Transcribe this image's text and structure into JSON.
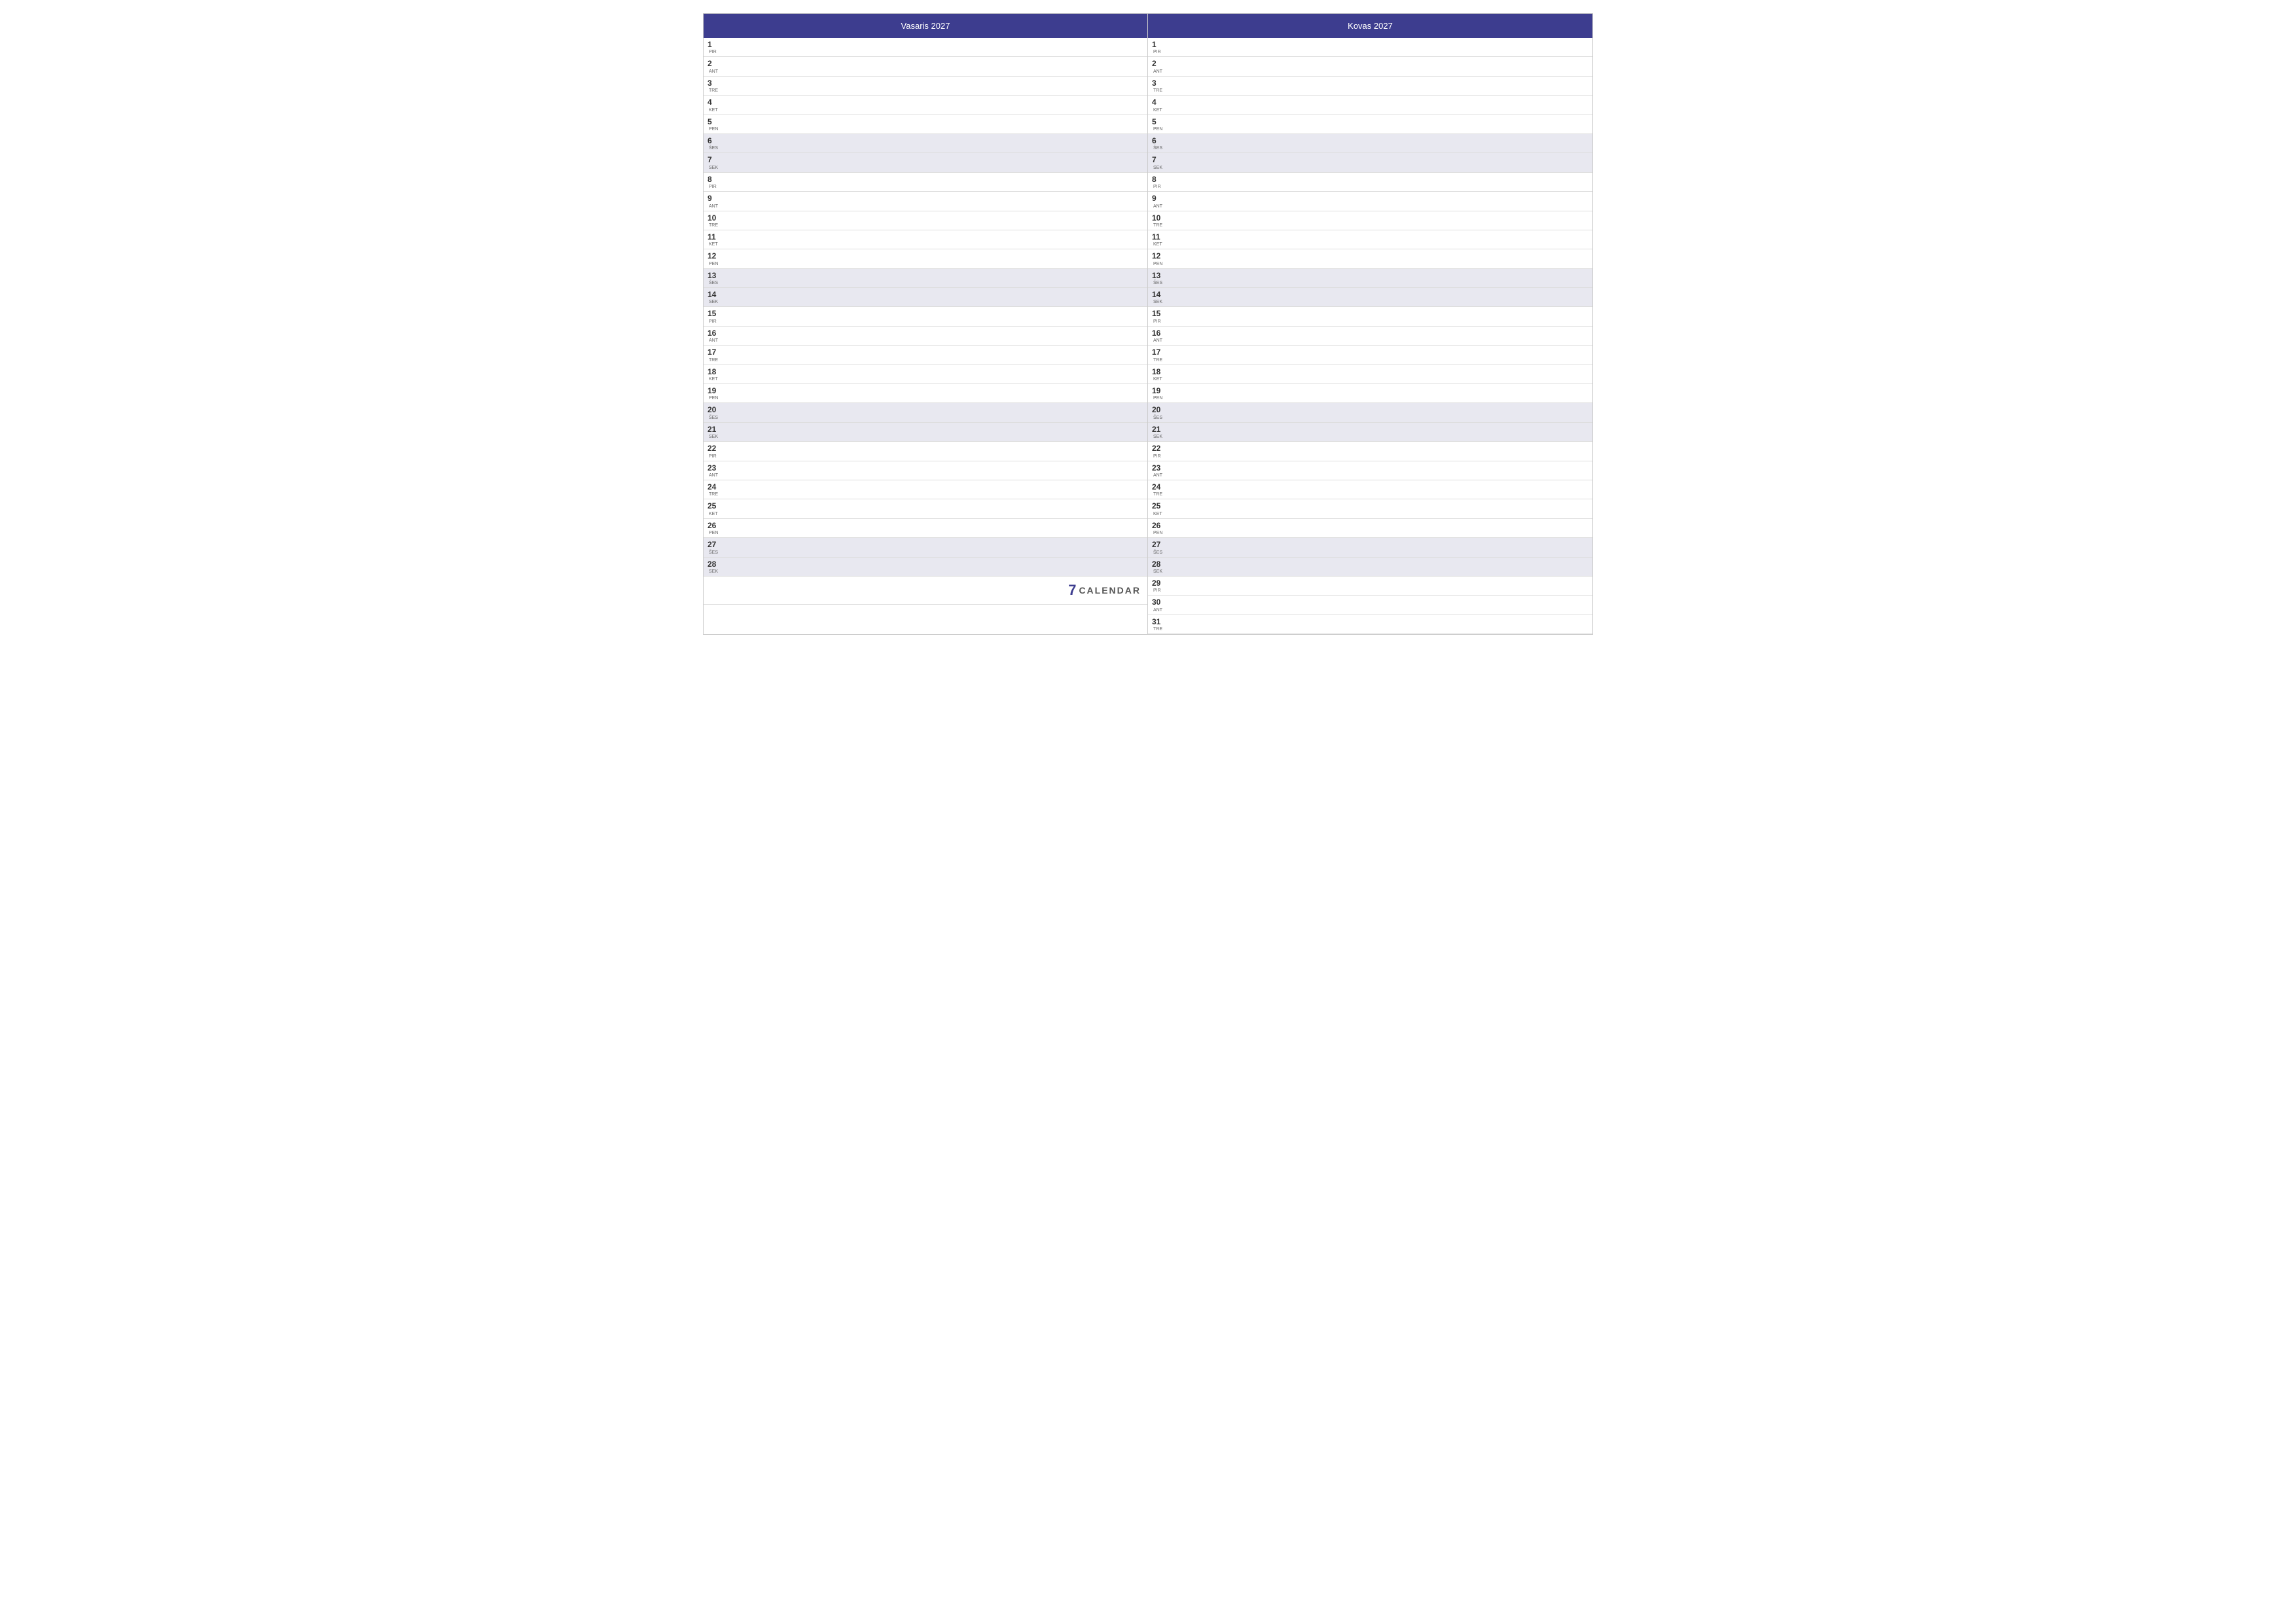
{
  "calendar": {
    "months": [
      {
        "id": "vasaris",
        "title": "Vasaris 2027",
        "days": [
          {
            "num": "1",
            "name": "PIR",
            "weekend": false
          },
          {
            "num": "2",
            "name": "ANT",
            "weekend": false
          },
          {
            "num": "3",
            "name": "TRE",
            "weekend": false
          },
          {
            "num": "4",
            "name": "KET",
            "weekend": false
          },
          {
            "num": "5",
            "name": "PEN",
            "weekend": false
          },
          {
            "num": "6",
            "name": "ŠES",
            "weekend": true
          },
          {
            "num": "7",
            "name": "SEK",
            "weekend": true
          },
          {
            "num": "8",
            "name": "PIR",
            "weekend": false
          },
          {
            "num": "9",
            "name": "ANT",
            "weekend": false
          },
          {
            "num": "10",
            "name": "TRE",
            "weekend": false
          },
          {
            "num": "11",
            "name": "KET",
            "weekend": false
          },
          {
            "num": "12",
            "name": "PEN",
            "weekend": false
          },
          {
            "num": "13",
            "name": "ŠES",
            "weekend": true
          },
          {
            "num": "14",
            "name": "SEK",
            "weekend": true
          },
          {
            "num": "15",
            "name": "PIR",
            "weekend": false
          },
          {
            "num": "16",
            "name": "ANT",
            "weekend": false
          },
          {
            "num": "17",
            "name": "TRE",
            "weekend": false
          },
          {
            "num": "18",
            "name": "KET",
            "weekend": false
          },
          {
            "num": "19",
            "name": "PEN",
            "weekend": false
          },
          {
            "num": "20",
            "name": "ŠES",
            "weekend": true
          },
          {
            "num": "21",
            "name": "SEK",
            "weekend": true
          },
          {
            "num": "22",
            "name": "PIR",
            "weekend": false
          },
          {
            "num": "23",
            "name": "ANT",
            "weekend": false
          },
          {
            "num": "24",
            "name": "TRE",
            "weekend": false
          },
          {
            "num": "25",
            "name": "KET",
            "weekend": false
          },
          {
            "num": "26",
            "name": "PEN",
            "weekend": false
          },
          {
            "num": "27",
            "name": "ŠES",
            "weekend": true
          },
          {
            "num": "28",
            "name": "SEK",
            "weekend": true
          }
        ],
        "footer": {
          "brand_number": "7",
          "brand_text": "CALENDAR"
        }
      },
      {
        "id": "kovas",
        "title": "Kovas 2027",
        "days": [
          {
            "num": "1",
            "name": "PIR",
            "weekend": false
          },
          {
            "num": "2",
            "name": "ANT",
            "weekend": false
          },
          {
            "num": "3",
            "name": "TRE",
            "weekend": false
          },
          {
            "num": "4",
            "name": "KET",
            "weekend": false
          },
          {
            "num": "5",
            "name": "PEN",
            "weekend": false
          },
          {
            "num": "6",
            "name": "ŠES",
            "weekend": true
          },
          {
            "num": "7",
            "name": "SEK",
            "weekend": true
          },
          {
            "num": "8",
            "name": "PIR",
            "weekend": false
          },
          {
            "num": "9",
            "name": "ANT",
            "weekend": false
          },
          {
            "num": "10",
            "name": "TRE",
            "weekend": false
          },
          {
            "num": "11",
            "name": "KET",
            "weekend": false
          },
          {
            "num": "12",
            "name": "PEN",
            "weekend": false
          },
          {
            "num": "13",
            "name": "ŠES",
            "weekend": true
          },
          {
            "num": "14",
            "name": "SEK",
            "weekend": true
          },
          {
            "num": "15",
            "name": "PIR",
            "weekend": false
          },
          {
            "num": "16",
            "name": "ANT",
            "weekend": false
          },
          {
            "num": "17",
            "name": "TRE",
            "weekend": false
          },
          {
            "num": "18",
            "name": "KET",
            "weekend": false
          },
          {
            "num": "19",
            "name": "PEN",
            "weekend": false
          },
          {
            "num": "20",
            "name": "ŠES",
            "weekend": true
          },
          {
            "num": "21",
            "name": "SEK",
            "weekend": true
          },
          {
            "num": "22",
            "name": "PIR",
            "weekend": false
          },
          {
            "num": "23",
            "name": "ANT",
            "weekend": false
          },
          {
            "num": "24",
            "name": "TRE",
            "weekend": false
          },
          {
            "num": "25",
            "name": "KET",
            "weekend": false
          },
          {
            "num": "26",
            "name": "PEN",
            "weekend": false
          },
          {
            "num": "27",
            "name": "ŠES",
            "weekend": true
          },
          {
            "num": "28",
            "name": "SEK",
            "weekend": true
          },
          {
            "num": "29",
            "name": "PIR",
            "weekend": false
          },
          {
            "num": "30",
            "name": "ANT",
            "weekend": false
          },
          {
            "num": "31",
            "name": "TRE",
            "weekend": false
          }
        ]
      }
    ]
  }
}
